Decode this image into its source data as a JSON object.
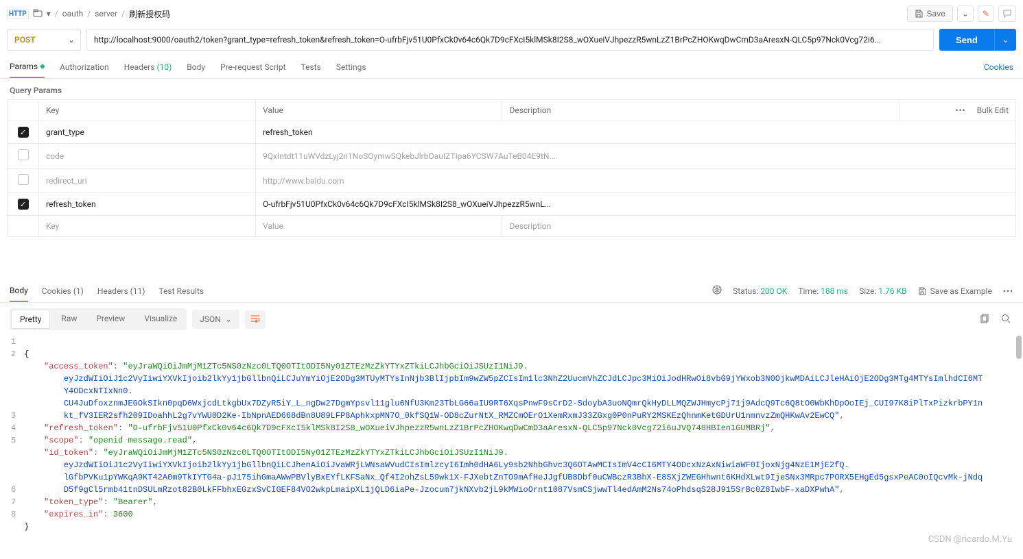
{
  "breadcrumb": {
    "http_badge": "HTTP",
    "folder_icon": "▭",
    "caret": "▾",
    "parts": [
      "oauth",
      "server"
    ],
    "last": "刷新授权码"
  },
  "top_actions": {
    "save_label": "Save",
    "save_caret": "⌄"
  },
  "request": {
    "method": "POST",
    "url": "http://localhost:9000/oauth2/token?grant_type=refresh_token&refresh_token=O-ufrbFjv51U0PfxCk0v64c6Qk7D9cFXcI5klMSk8I2S8_wOXueiVJhpezzR5wnLzZ1BrPcZHOKwqDwCmD3aAresxN-QLC5p97Nck0Vcg72i6...",
    "send_label": "Send"
  },
  "tabs": {
    "params": "Params",
    "auth": "Authorization",
    "headers": "Headers",
    "headers_count": "(10)",
    "body": "Body",
    "prereq": "Pre-request Script",
    "tests": "Tests",
    "settings": "Settings",
    "cookies": "Cookies"
  },
  "query_section_title": "Query Params",
  "param_headers": {
    "key": "Key",
    "value": "Value",
    "desc": "Description",
    "bulk": "Bulk Edit"
  },
  "params": [
    {
      "checked": true,
      "key": "grant_type",
      "value": "refresh_token",
      "muted": false
    },
    {
      "checked": false,
      "key": "code",
      "value": "9QxIntdt11uWVdzLyj2n1NoSOymwSQkebJlrbOauIZTIpa6YCSW7AuTeB04E9tN...",
      "muted": true
    },
    {
      "checked": false,
      "key": "redirect_uri",
      "value": "http://www.baidu.com",
      "muted": true
    },
    {
      "checked": true,
      "key": "refresh_token",
      "value": "O-ufrbFjv51U0PfxCk0v64c6Qk7D9cFXcI5klMSk8I2S8_wOXueiVJhpezzR5wnL...",
      "muted": false
    }
  ],
  "placeholder_row": {
    "key": "Key",
    "value": "Value",
    "desc": "Description"
  },
  "response": {
    "tabs": {
      "body": "Body",
      "cookies": "Cookies",
      "cookies_count": "(1)",
      "headers": "Headers",
      "headers_count": "(11)",
      "tests": "Test Results"
    },
    "meta": {
      "status_label": "Status:",
      "status_value": "200 OK",
      "time_label": "Time:",
      "time_value": "188 ms",
      "size_label": "Size:",
      "size_value": "1.76 KB",
      "save_example": "Save as Example"
    },
    "viewmodes": {
      "pretty": "Pretty",
      "raw": "Raw",
      "preview": "Preview",
      "visualize": "Visualize"
    },
    "lang": "JSON"
  },
  "json_lines": {
    "l1": "{",
    "l2_key": "\"access_token\"",
    "l2_val_a": "\"eyJraWQiOiJmMjM1ZTc5NS0zNzc0LTQ0OTItODI5Ny01ZTEzMzZkYTYxZTkiLCJhbGciOiJSUzI1NiJ9.",
    "l2_wrap1": "eyJzdWIiOiJ1c2VyIiwiYXVkIjoib2lkYy1jbGllbnQiLCJuYmYiOjE2ODg3MTUyMTYsInNjb3BlIjpbIm9wZW5pZCIsIm1lc3NhZ2UucmVhZCJdLCJpc3MiOiJodHRwOi8vbG9jYWxob3N0OjkwMDAiLCJleHAiOjE2ODg3MTg4MTYsImlhdCI6MT",
    "l2_wrap2": "Y4ODcxNTIxNn0.",
    "l2_wrap3": "CU4JuDfoxznmJEGOkSIkn0pqD6WxjcdLtkgbUx7DZyR5iY_L_ngDw27DgmYpsvl11glu6NfU3Km23TbLG66aIU9RT6XqsPnwF9sCrD2-SdoybA3uoNQmrQkHyDLLMQZWJHmycPj71j9AdcQ9Tc6Q8tO0WbKhDpOoIEj_CUI97K8iPlTxPizkrbPY1n",
    "l2_wrap4": "kt_fV3IER2sfh209IDoahhL2g7vYWU0D2Ke-IbNpnAED668dBn8U89LFP8AphkxpMN7O_0kfSQ1W-OD8cZurNtX_RMZCmOErO1XemRxmJ33ZGxg0P0nPuRY2MSKEzQhnmKetGDUrU1nmnvzZmQHKwAv2EwCQ\"",
    "l3_key": "\"refresh_token\"",
    "l3_val": "\"O-ufrbFjv51U0PfxCk0v64c6Qk7D9cFXcI5klMSk8I2S8_wOXueiVJhpezzR5wnLzZ1BrPcZHOKwqDwCmD3aAresxN-QLC5p97Nck0Vcg72i6uJVQ748HBIen1GUMBRj\"",
    "l4_key": "\"scope\"",
    "l4_val": "\"openid message.read\"",
    "l5_key": "\"id_token\"",
    "l5_val_a": "\"eyJraWQiOiJmMjM1ZTc5NS0zNzc0LTQ0OTItODI5Ny01ZTEzMzZkYTYxZTkiLCJhbGciOiJSUzI1NiJ9.",
    "l5_wrap1": "eyJzdWIiOiJ1c2VyIiwiYXVkIjoib2lkYy1jbGllbnQiLCJhenAiOiJvaWRjLWNsaWVudCIsImlzcyI6Imh0dHA6Ly9sb2NhbGhvc3Q6OTAwMCIsImV4cCI6MTY4ODcxNzAxNiwiaWF0IjoxNjg4NzE1MjE2fQ.",
    "l5_wrap2": "lGfbPVKu1pYWKqA9KT42A0m9TkIYTG4a-pJ175ihGmaAWwPBVlyBxEYfLKFSaNx_Qf4I2ohZsL59wk1X-FJXebtZnTO9mAfHeJJgfUB8Dbf0uCWBczR3BhX-E8SXjZWEGHhwnt6KHdXLwt9IjeSNx3MRpc7PORX5EHgEd5gsxPeAC0oIQcvMk-jNdq",
    "l5_wrap3": "D5f9gCl5rmb41tnDSULmRzot82B0LkFFbhxEGzxSvCIGEF84VO2wkpLmaipXL1jQLD6iaPe-Jzocum7jkNXvb2jL9kMWioOrnt1087VsmCSjwwTl4edAmM2Ns74oPhdsqS28J915SrBc0Z8IwbF-xaDXPwhA\"",
    "l6_key": "\"token_type\"",
    "l6_val": "\"Bearer\"",
    "l7_key": "\"expires_in\"",
    "l7_val": "3600",
    "l8": "}"
  },
  "watermark": "CSDN @ricardo.M.Yu"
}
